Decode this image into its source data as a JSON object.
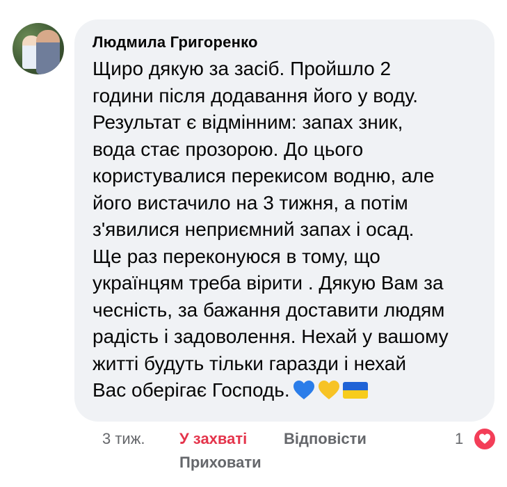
{
  "comment": {
    "author": "Людмила Григоренко",
    "lines": [
      "Щиро дякую за засіб. Пройшло 2",
      "години після додавання його у воду.",
      "Результат є відмінним: запах зник,",
      "вода стає прозорою. До цього",
      "користувалися перекисом водню, але",
      "його вистачило на 3 тижня, а потім",
      "з'явилися неприємний запах і осад.",
      "Ще раз переконуюся в тому, що",
      "українцям треба вірити . Дякую Вам за",
      "чесність, за бажання доставити людям",
      "радість і задоволення. Нехай у вашому",
      "житті будуть тільки гаразди і нехай",
      "Вас оберігає Господь."
    ],
    "emojis": [
      "blue-heart",
      "yellow-heart",
      "ukraine-flag"
    ]
  },
  "actions": {
    "time": "3 тиж.",
    "reaction_label": "У захваті",
    "reply": "Відповісти",
    "hide": "Приховати",
    "reaction_count": "1",
    "reaction_icon": "love-heart-icon"
  },
  "colors": {
    "bubble": "#f0f2f5",
    "reaction_active": "#e4344b",
    "muted": "#65676b"
  }
}
